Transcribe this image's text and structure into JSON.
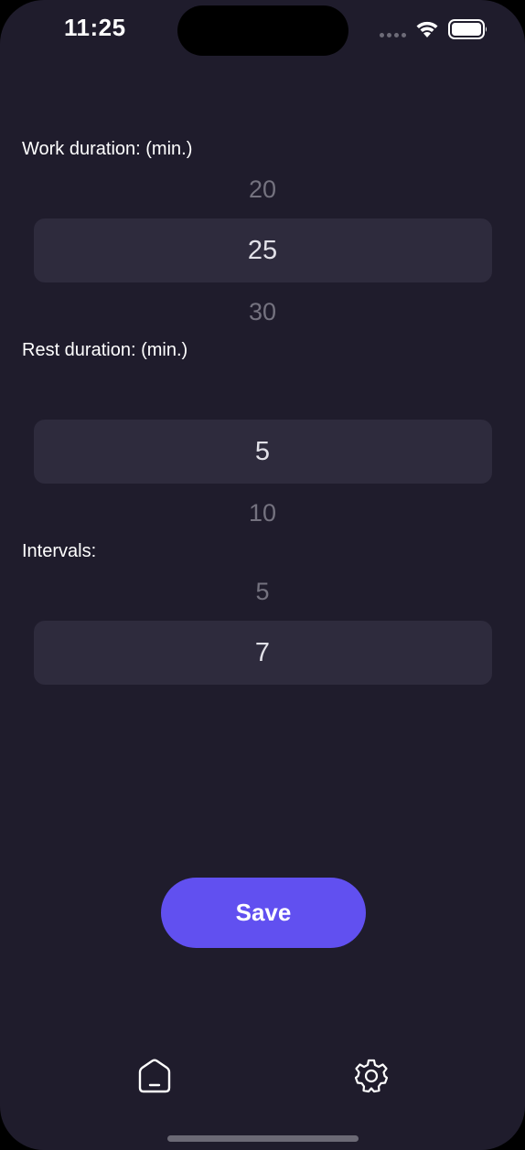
{
  "status_bar": {
    "time": "11:25",
    "icons": [
      "cellular-dots-icon",
      "wifi-icon",
      "battery-icon"
    ]
  },
  "settings": {
    "work": {
      "label": "Work duration: (min.)",
      "above": "20",
      "selected": "25",
      "below": "30"
    },
    "rest": {
      "label": "Rest duration: (min.)",
      "above": "",
      "selected": "5",
      "below": "10"
    },
    "intervals": {
      "label": "Intervals:",
      "above": "5",
      "selected": "7",
      "below": ""
    }
  },
  "save_button": {
    "label": "Save"
  },
  "tab_bar": {
    "items": [
      {
        "icon": "home-icon"
      },
      {
        "icon": "gear-icon"
      }
    ]
  },
  "colors": {
    "background": "#1f1c2c",
    "picker_highlight": "#2e2b3d",
    "accent": "#6150f0",
    "faded_text": "#74727f"
  }
}
